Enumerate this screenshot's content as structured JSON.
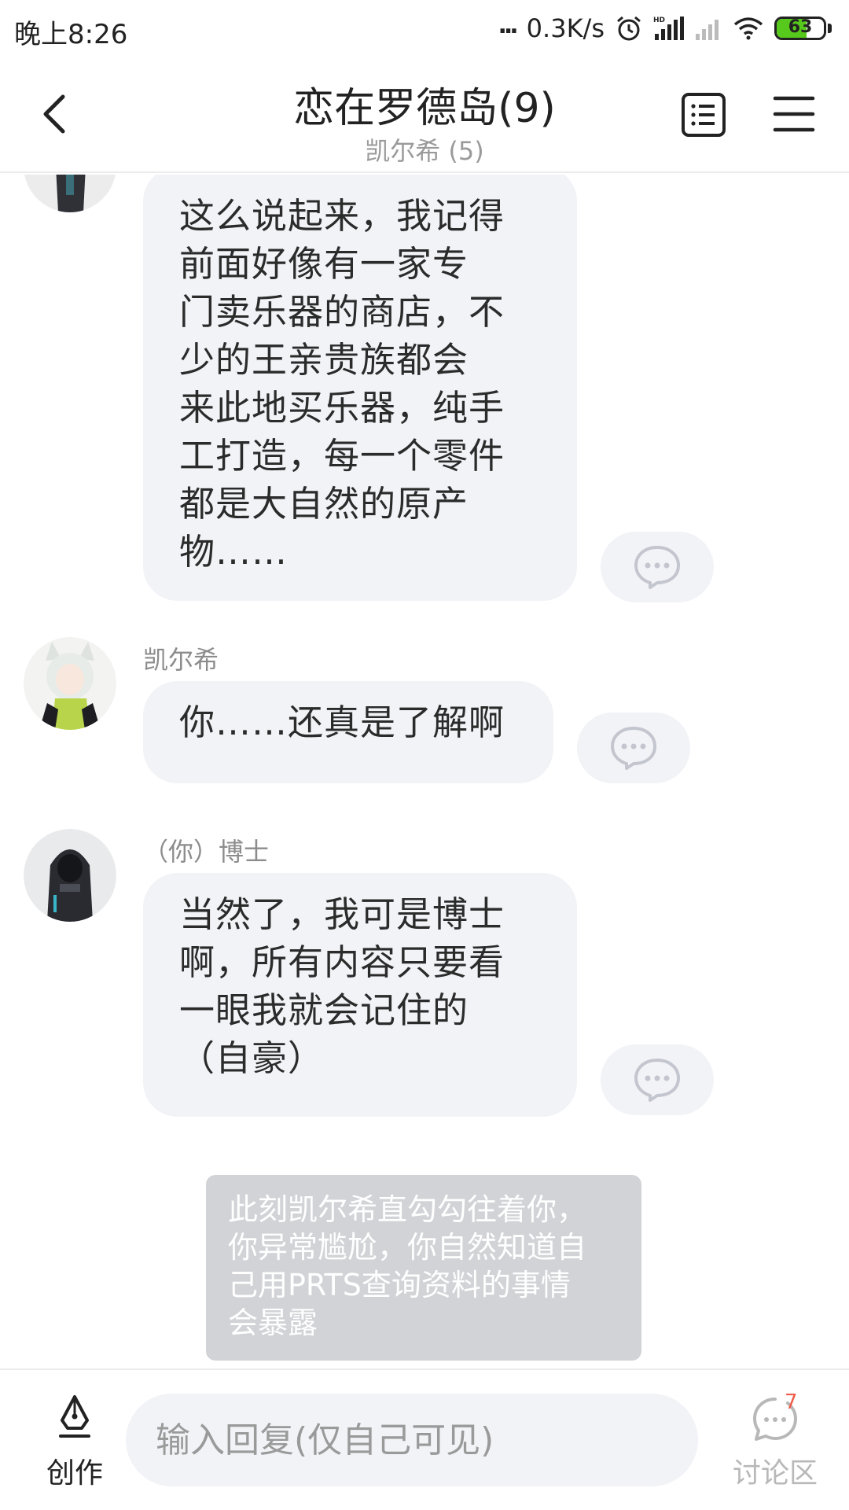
{
  "status_bar": {
    "time": "晚上8:26",
    "net_speed": "0.3K/s",
    "battery": "63",
    "battery_level_percent": 63
  },
  "header": {
    "title": "恋在罗德岛(9)",
    "subtitle": "凯尔希 (5)",
    "icons": [
      "back-icon",
      "list-icon",
      "menu-icon"
    ]
  },
  "messages": [
    {
      "sender": "",
      "text": "这么说起来，我记得\n前面好像有一家专\n门卖乐器的商店，不\n少的王亲贵族都会\n来此地买乐器，纯手\n工打造，每一个零件\n都是大自然的原产\n物……"
    },
    {
      "sender": "凯尔希",
      "text": "你……还真是了解啊"
    },
    {
      "sender": "（你）博士",
      "text": "当然了，我可是博士\n啊，所有内容只要看\n一眼我就会记住的\n（自豪）"
    }
  ],
  "narration": "此刻凯尔希直勾勾往着你，\n你异常尴尬，你自然知道自\n己用PRTS查询资料的事情\n会暴露",
  "bottom_bar": {
    "create_label": "创作",
    "input_placeholder": "输入回复(仅自己可见)",
    "discuss_label": "讨论区",
    "discuss_count": "7"
  },
  "colors": {
    "bubble_bg": "#f2f3f7",
    "narration_bg": "#d2d3d7",
    "battery_green": "#57c81c",
    "badge_red": "#f05b4a"
  }
}
